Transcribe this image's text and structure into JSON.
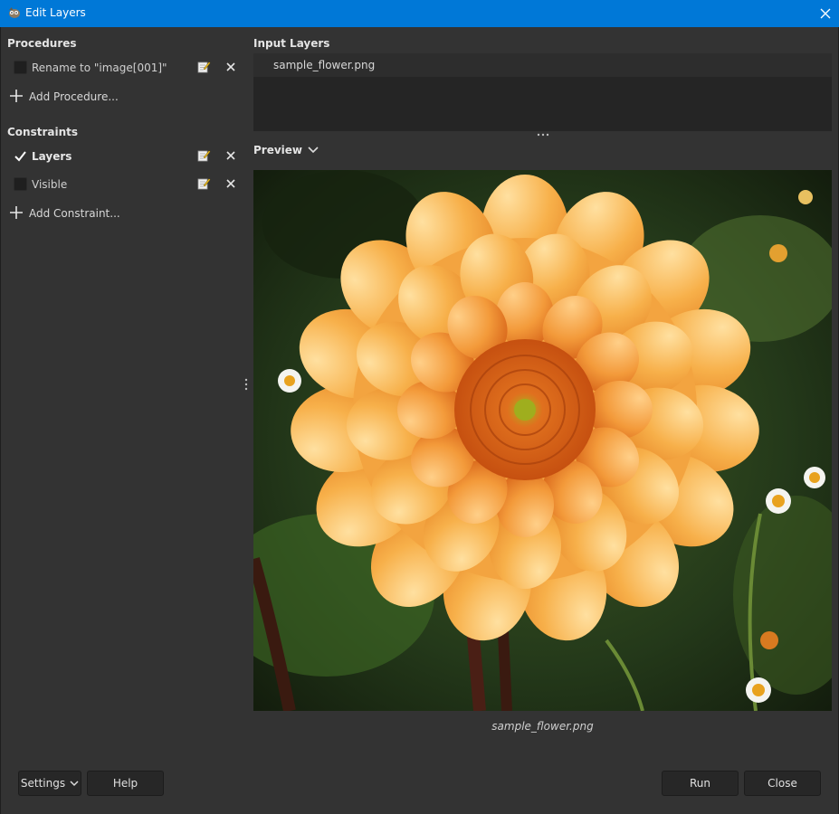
{
  "window": {
    "title": "Edit Layers",
    "icon": "gimp-wilber-icon",
    "close_icon": "close-icon"
  },
  "procedures": {
    "heading": "Procedures",
    "items": [
      {
        "label": "Rename to \"image[001]\"",
        "checked": false,
        "edit_icon": "edit-icon",
        "delete_icon": "delete-icon"
      }
    ],
    "add_label": "Add Procedure..."
  },
  "constraints": {
    "heading": "Constraints",
    "items": [
      {
        "label": "Layers",
        "checked": true,
        "edit_icon": "edit-icon",
        "delete_icon": "delete-icon"
      },
      {
        "label": "Visible",
        "checked": false,
        "edit_icon": "edit-icon",
        "delete_icon": "delete-icon"
      }
    ],
    "add_label": "Add Constraint..."
  },
  "input_layers": {
    "heading": "Input Layers",
    "items": [
      "sample_flower.png"
    ]
  },
  "preview": {
    "heading": "Preview",
    "image_caption": "sample_flower.png"
  },
  "buttons": {
    "settings": "Settings",
    "help": "Help",
    "run": "Run",
    "close": "Close"
  },
  "colors": {
    "titlebar": "#0078d7",
    "background": "#333333",
    "petal_outer": "#f7b04a",
    "petal_inner": "#f08a2c"
  }
}
